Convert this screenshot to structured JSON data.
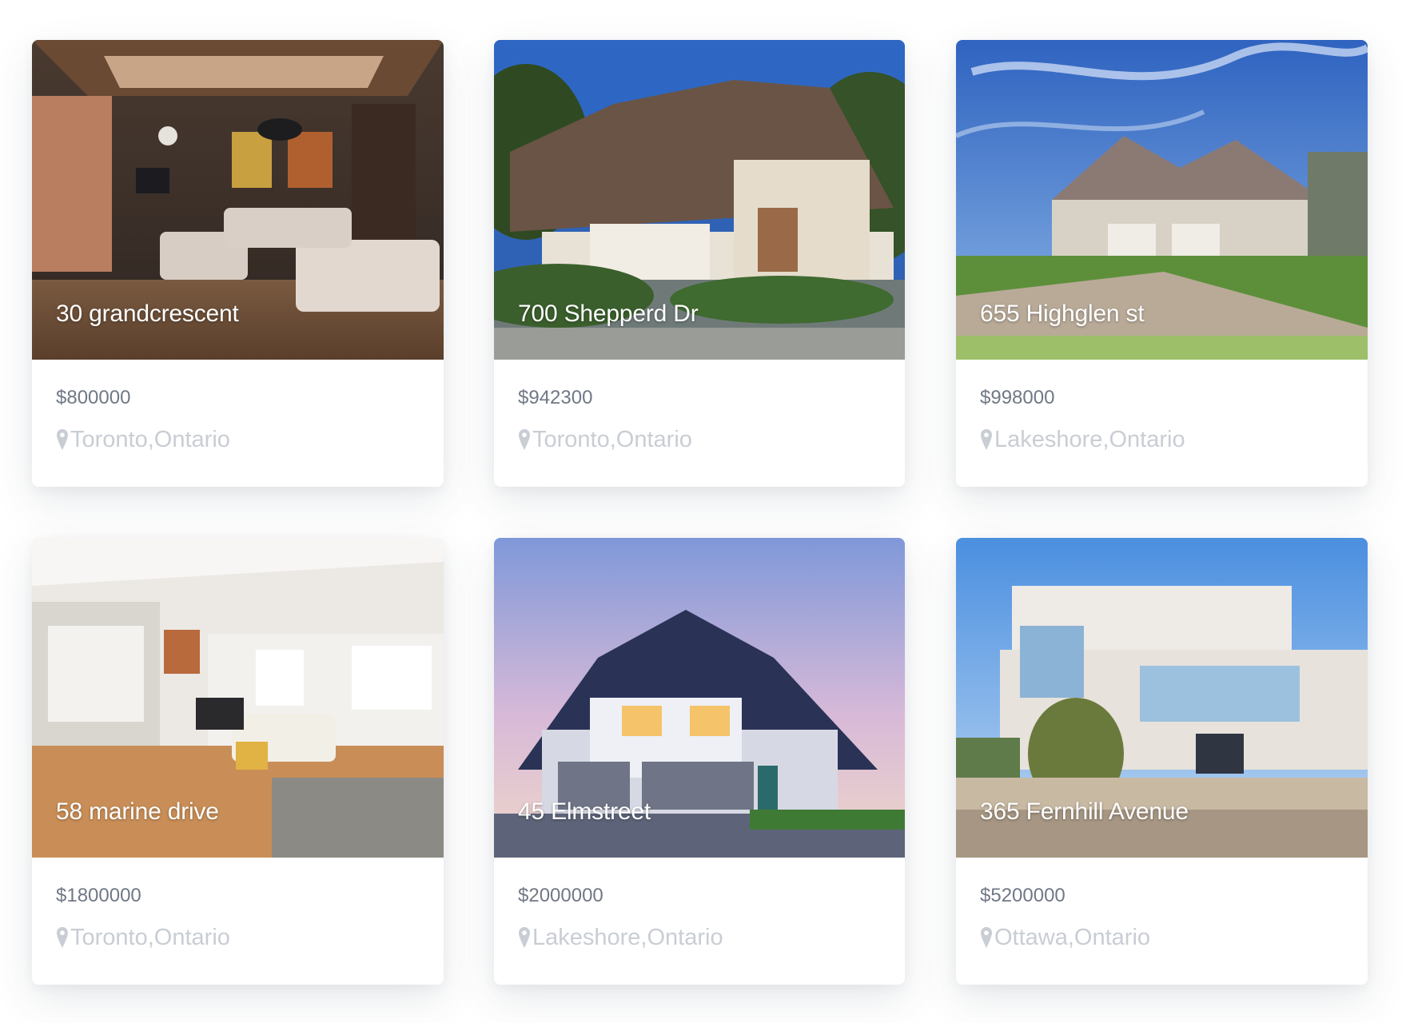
{
  "listings": [
    {
      "title": "30 grandcrescent",
      "price": "$800000",
      "location": "Toronto,Ontario",
      "photo_icon": "living-room-photo"
    },
    {
      "title": "700 Shepperd Dr",
      "price": "$942300",
      "location": "Toronto,Ontario",
      "photo_icon": "house-photo"
    },
    {
      "title": "655 Highglen st",
      "price": "$998000",
      "location": "Lakeshore,Ontario",
      "photo_icon": "house-photo"
    },
    {
      "title": "58 marine drive",
      "price": "$1800000",
      "location": "Toronto,Ontario",
      "photo_icon": "living-room-photo"
    },
    {
      "title": "45 Elmstreet",
      "price": "$2000000",
      "location": "Lakeshore,Ontario",
      "photo_icon": "house-photo"
    },
    {
      "title": "365 Fernhill Avenue",
      "price": "$5200000",
      "location": "Ottawa,Ontario",
      "photo_icon": "house-photo"
    }
  ],
  "colors": {
    "price_text": "#707885",
    "location_text": "#c9cdd4",
    "title_text": "#ffffff",
    "card_bg": "#ffffff"
  },
  "icons": {
    "location": "map-pin-icon"
  }
}
